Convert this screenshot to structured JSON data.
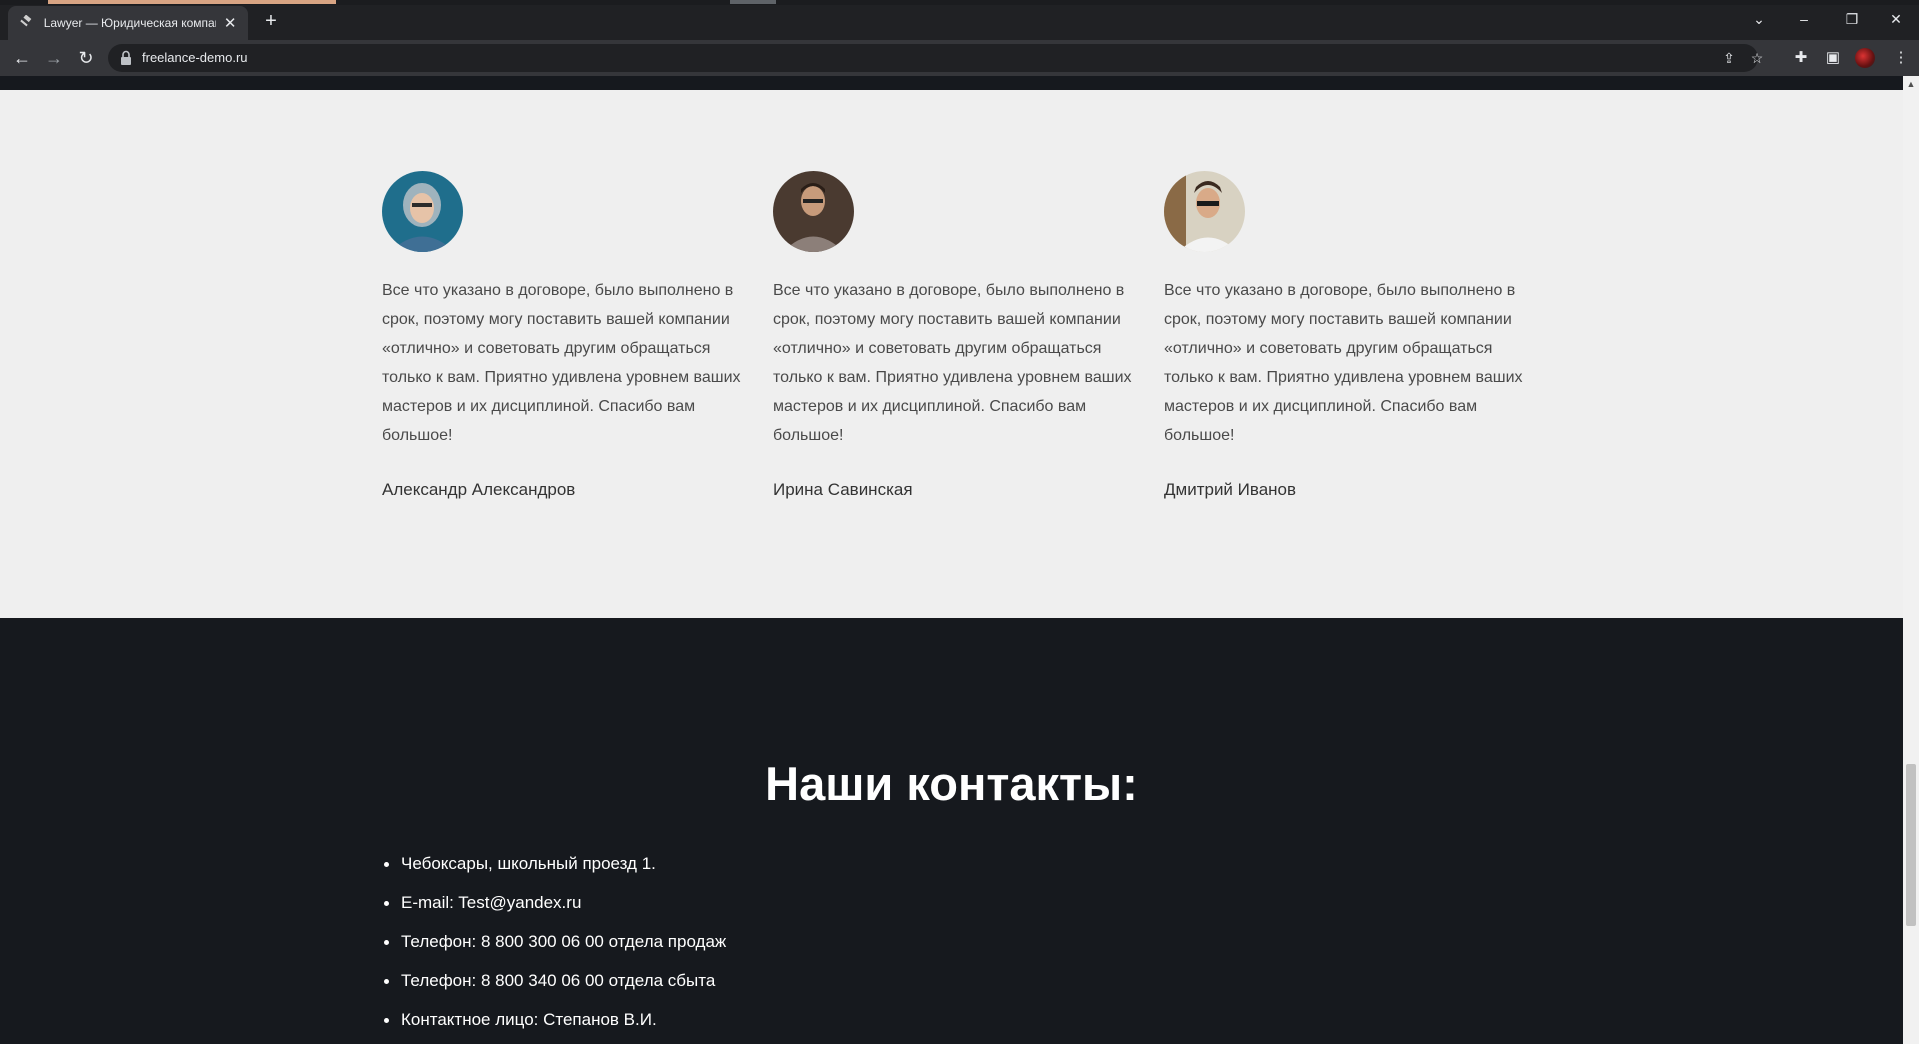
{
  "browser": {
    "tab_title": "Lawyer — Юридическая компания",
    "tab_favicon": "gavel-icon",
    "url": "freelance-demo.ru"
  },
  "reviews": [
    {
      "text": "Все что указано в договоре, было выполнено в срок, поэтому могу поставить вашей компании «отлично» и советовать другим обращаться только к вам. Приятно удивлена уровнем ваших мастеров и их дисциплиной. Спасибо вам большое!",
      "author": "Александр Александров",
      "photo": "avatar-woman-hood"
    },
    {
      "text": "Все что указано в договоре, было выполнено в срок, поэтому могу поставить вашей компании «отлично» и советовать другим обращаться только к вам. Приятно удивлена уровнем ваших мастеров и их дисциплиной. Спасибо вам большое!",
      "author": "Ирина Савинская",
      "photo": "avatar-man-glasses"
    },
    {
      "text": "Все что указано в договоре, было выполнено в срок, поэтому могу поставить вашей компании «отлично» и советовать другим обращаться только к вам. Приятно удивлена уровнем ваших мастеров и их дисциплиной. Спасибо вам большое!",
      "author": "Дмитрий Иванов",
      "photo": "avatar-man-sunglasses"
    }
  ],
  "contacts": {
    "title": "Наши контакты:",
    "items": [
      "Чебоксары, школьный проезд 1.",
      "E-mail: Test@yandex.ru",
      "Телефон: 8 800 300 06 00 отдела продаж",
      "Телефон: 8 800 340 06 00 отдела сбыта",
      "Контактное лицо: Степанов В.И."
    ]
  },
  "colors": {
    "reviews_bg": "#efefef",
    "contacts_bg": "#16191e",
    "browser_frame": "#202124",
    "toolbar": "#35363a"
  }
}
